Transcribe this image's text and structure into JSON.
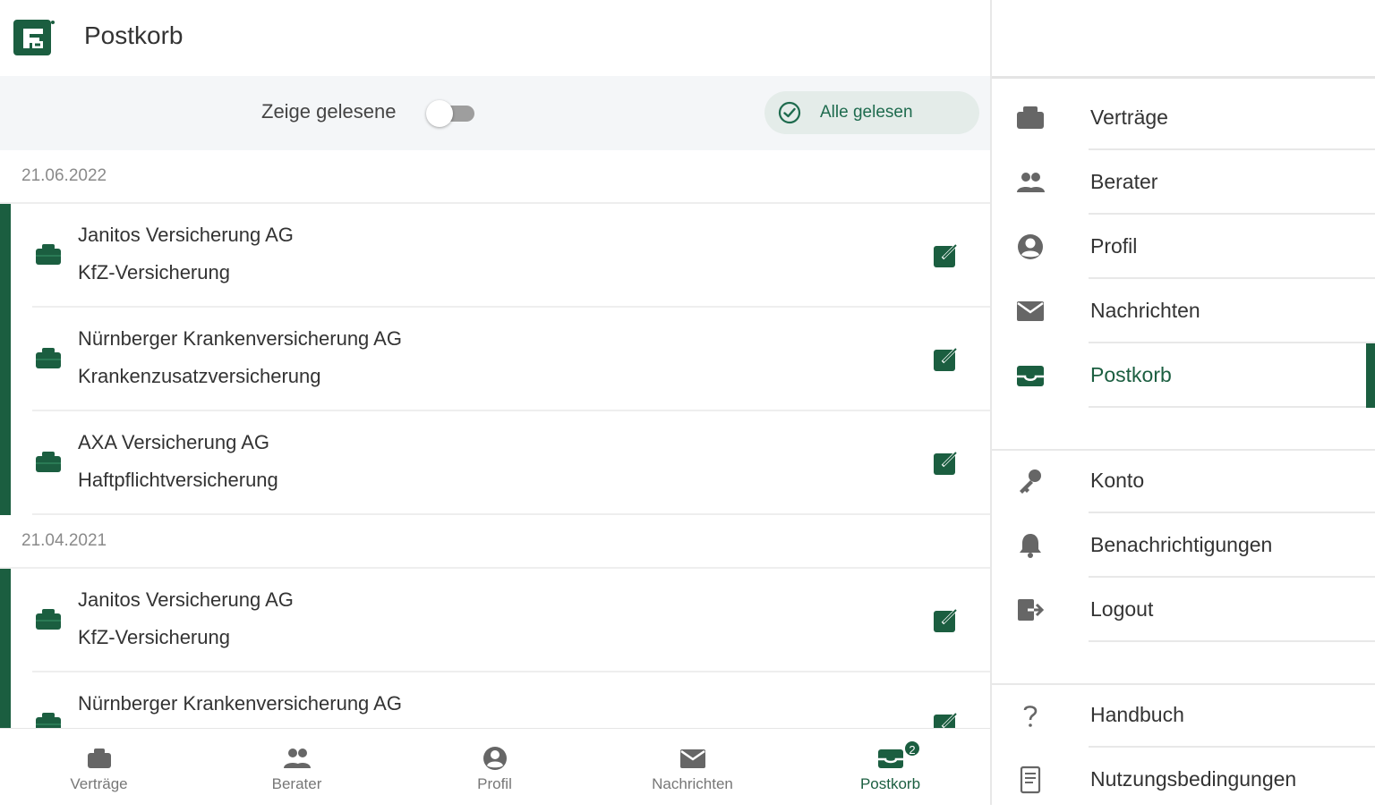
{
  "header": {
    "title": "Postkorb"
  },
  "filter": {
    "toggle_label": "Zeige gelesene",
    "toggle_on": false,
    "mark_all_label": "Alle gelesen"
  },
  "groups": [
    {
      "date": "21.06.2022",
      "items": [
        {
          "company": "Janitos Versicherung AG",
          "product": "KfZ-Versicherung"
        },
        {
          "company": "Nürnberger Krankenversicherung AG",
          "product": "Krankenzusatzversicherung"
        },
        {
          "company": "AXA Versicherung AG",
          "product": "Haftpflichtversicherung"
        }
      ]
    },
    {
      "date": "21.04.2021",
      "items": [
        {
          "company": "Janitos Versicherung AG",
          "product": "KfZ-Versicherung"
        },
        {
          "company": "Nürnberger Krankenversicherung AG",
          "product": ""
        }
      ]
    }
  ],
  "bottom_nav": [
    {
      "label": "Verträge",
      "icon": "briefcase-icon"
    },
    {
      "label": "Berater",
      "icon": "people-icon"
    },
    {
      "label": "Profil",
      "icon": "account-icon"
    },
    {
      "label": "Nachrichten",
      "icon": "mail-icon"
    },
    {
      "label": "Postkorb",
      "icon": "inbox-icon",
      "badge": "2",
      "active": true
    }
  ],
  "drawer": {
    "main": [
      {
        "label": "Verträge",
        "icon": "briefcase-icon"
      },
      {
        "label": "Berater",
        "icon": "people-icon"
      },
      {
        "label": "Profil",
        "icon": "account-icon"
      },
      {
        "label": "Nachrichten",
        "icon": "mail-icon"
      },
      {
        "label": "Postkorb",
        "icon": "inbox-icon",
        "active": true
      }
    ],
    "account": [
      {
        "label": "Konto",
        "icon": "key-icon"
      },
      {
        "label": "Benachrichtigungen",
        "icon": "bell-icon"
      },
      {
        "label": "Logout",
        "icon": "logout-icon"
      }
    ],
    "info": [
      {
        "label": "Handbuch",
        "icon": "question-icon"
      },
      {
        "label": "Nutzungsbedingungen",
        "icon": "document-icon"
      }
    ]
  },
  "colors": {
    "brand": "#1b5e40",
    "accent_text": "#1e6b4e",
    "filter_bg": "#f4f6f8",
    "pill_bg": "#e4ece9"
  }
}
